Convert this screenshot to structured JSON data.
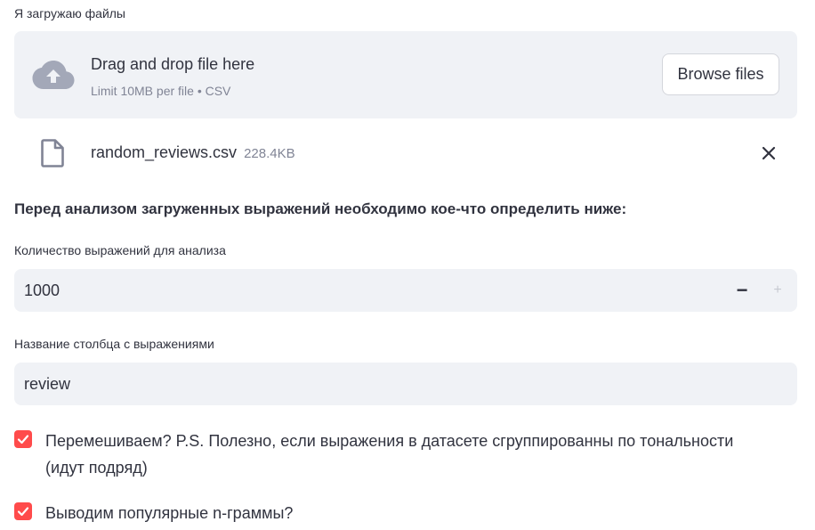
{
  "uploader": {
    "label": "Я загружаю файлы",
    "dropzone_title": "Drag and drop file here",
    "dropzone_subtitle": "Limit 10MB per file • CSV",
    "browse_label": "Browse files",
    "file": {
      "name": "random_reviews.csv",
      "size": "228.4KB"
    },
    "icons": {
      "upload": "cloud-upload-icon",
      "file": "file-icon",
      "remove": "close-icon"
    }
  },
  "section_heading": "Перед анализом загруженных выражений необходимо кое-что определить ниже:",
  "count_input": {
    "label": "Количество выражений для анализа",
    "value": "1000",
    "decrement": "−",
    "increment": "+"
  },
  "column_input": {
    "label": "Название столбца с выражениями",
    "value": "review"
  },
  "checkboxes": [
    {
      "label": "Перемешиваем? P.S. Полезно, если выражения в датасете сгруппированны по тональности (идут подряд)",
      "checked": true
    },
    {
      "label": "Выводим популярные n-граммы?",
      "checked": true
    }
  ],
  "colors": {
    "accent": "#ff4b4b",
    "field_bg": "#f0f2f6",
    "text": "#31333f",
    "muted": "#808495"
  }
}
